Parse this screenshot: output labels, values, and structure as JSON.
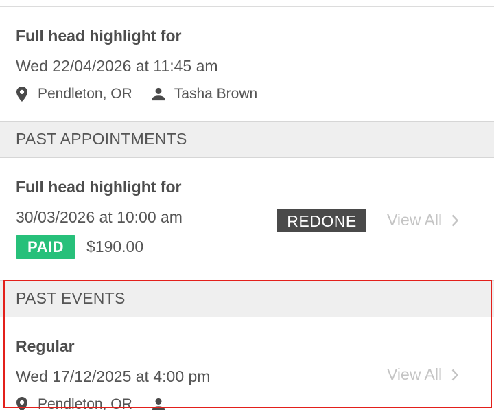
{
  "upcoming": {
    "title": "Full head highlight for",
    "datetime": "Wed 22/04/2026 at 11:45 am",
    "location": "Pendleton, OR",
    "staff": "Tasha Brown"
  },
  "past_appointments": {
    "header": "PAST APPOINTMENTS",
    "item": {
      "title": "Full head highlight for",
      "datetime": "30/03/2026 at 10:00 am",
      "status_badge": "REDONE",
      "payment_badge": "PAID",
      "price": "$190.00",
      "view_all": "View All"
    }
  },
  "past_events": {
    "header": "PAST EVENTS",
    "item": {
      "title": "Regular",
      "datetime": "Wed 17/12/2025 at 4:00 pm",
      "location": "Pendleton, OR",
      "view_all": "View All"
    }
  },
  "colors": {
    "paid_green": "#27c07a",
    "redone_gray": "#4a4a4a",
    "highlight_red": "#e3201b"
  },
  "icons": [
    "location-pin-icon",
    "person-icon",
    "chevron-right-icon"
  ]
}
